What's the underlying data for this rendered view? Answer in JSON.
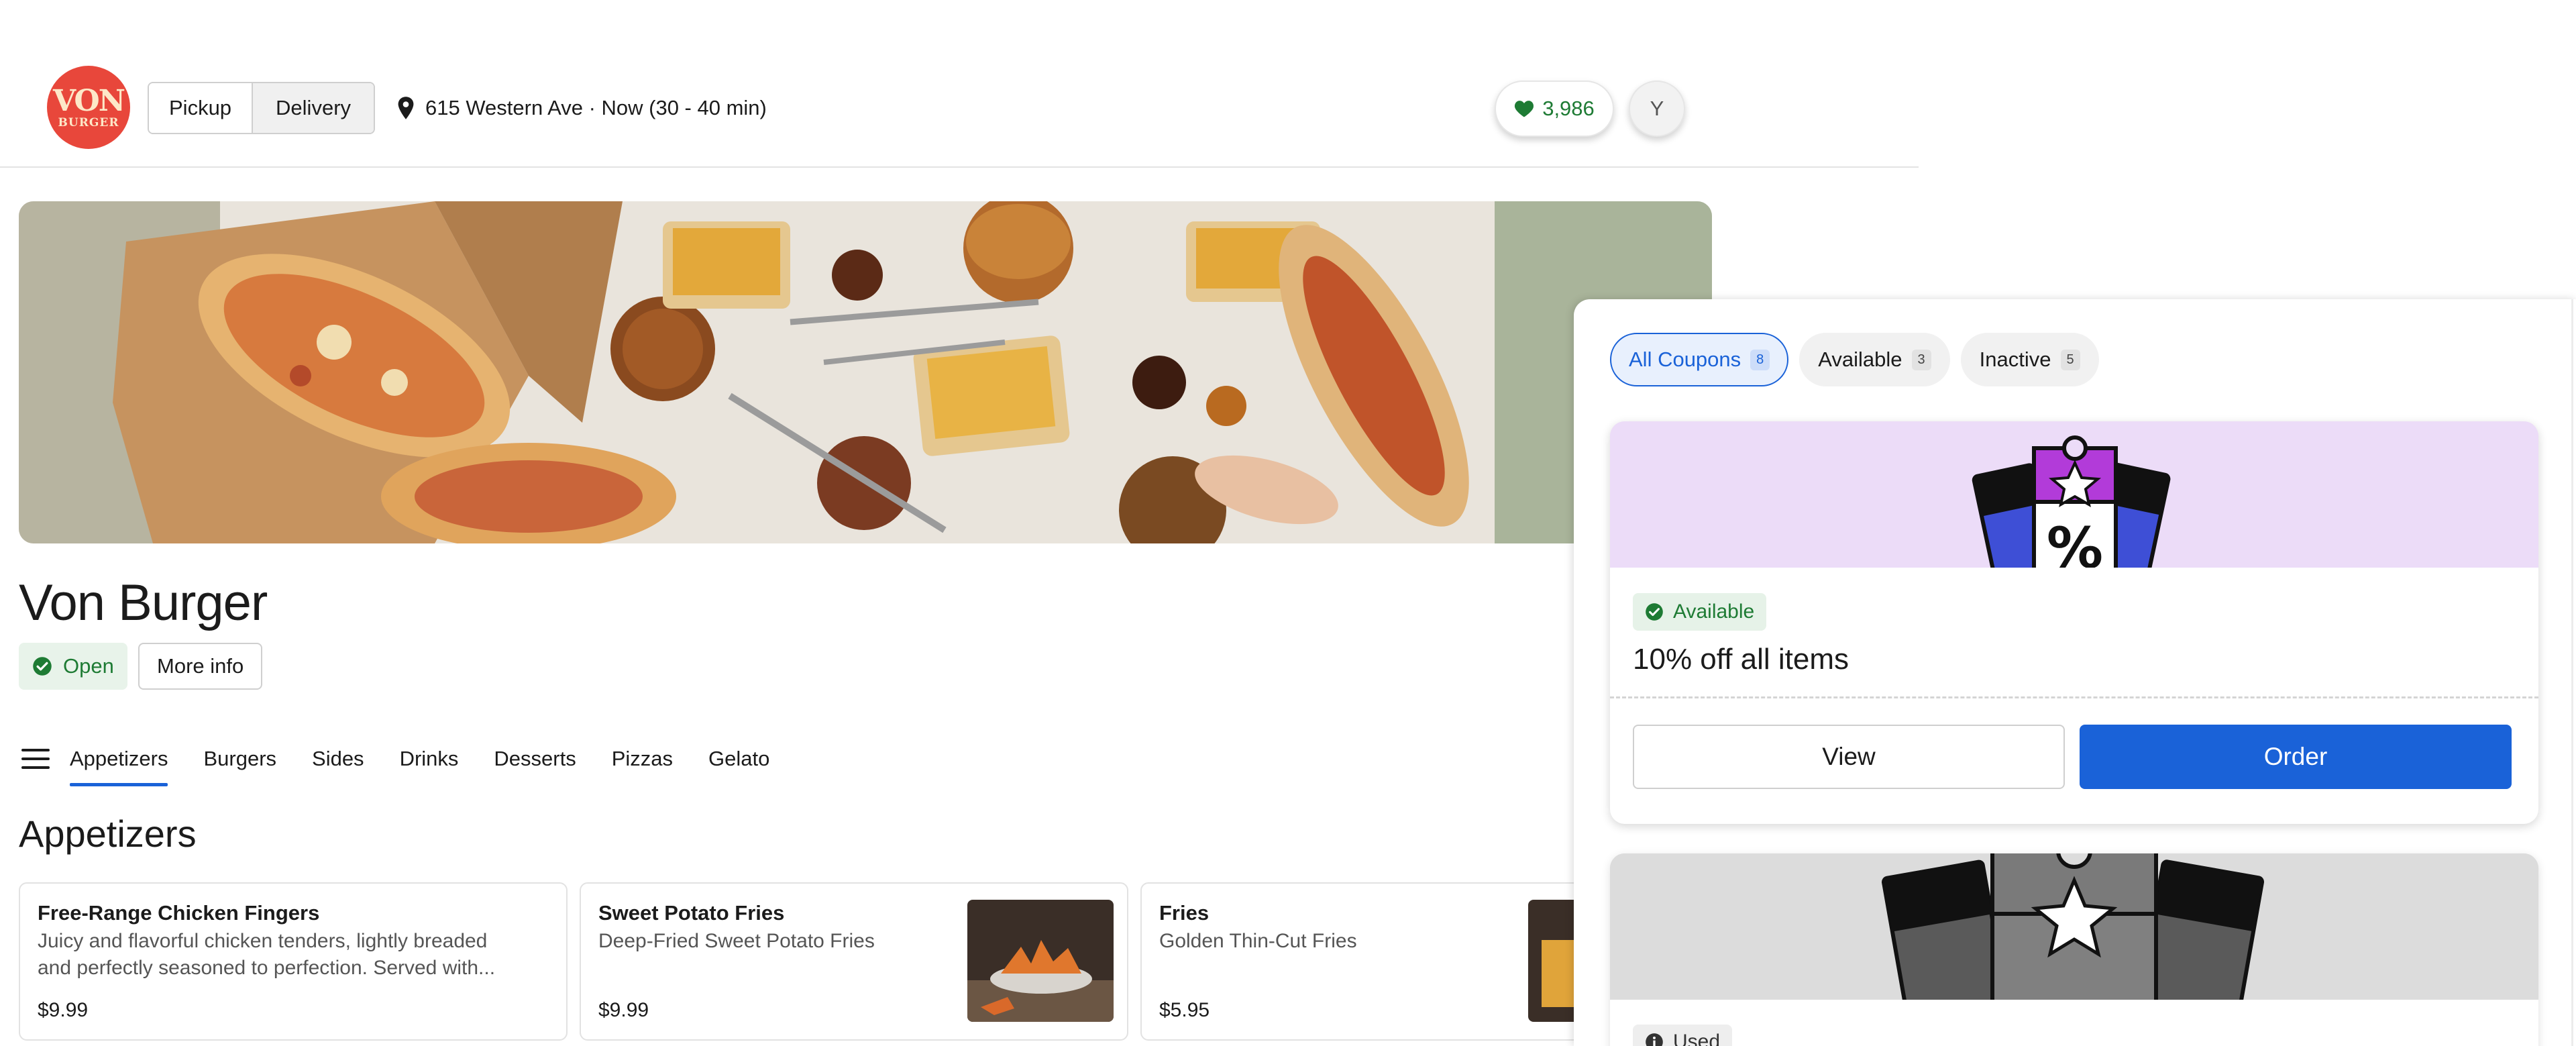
{
  "header": {
    "logo_text_line1": "VON",
    "logo_text_line2": "BURGER",
    "mode_options": [
      "Pickup",
      "Delivery"
    ],
    "address": "615 Western Ave · Now (30 - 40 min)",
    "favorites_count": "3,986",
    "avatar_initial": "Y"
  },
  "restaurant": {
    "name": "Von Burger",
    "status": "Open",
    "more_info_label": "More info"
  },
  "categories": [
    "Appetizers",
    "Burgers",
    "Sides",
    "Drinks",
    "Desserts",
    "Pizzas",
    "Gelato"
  ],
  "active_category": "Appetizers",
  "section_title": "Appetizers",
  "menu_items": [
    {
      "name": "Free-Range Chicken Fingers",
      "desc_line1": "Juicy and flavorful chicken tenders, lightly breaded",
      "desc_line2": "and perfectly seasoned to perfection. Served with...",
      "price": "$9.99"
    },
    {
      "name": "Sweet Potato Fries",
      "desc_line1": "Deep-Fried Sweet Potato Fries",
      "price": "$9.99"
    },
    {
      "name": "Fries",
      "desc_line1": "Golden Thin-Cut Fries",
      "price": "$5.95"
    }
  ],
  "coupons": {
    "tabs": [
      {
        "label": "All Coupons",
        "count": "8"
      },
      {
        "label": "Available",
        "count": "3"
      },
      {
        "label": "Inactive",
        "count": "5"
      }
    ],
    "active_tab": "All Coupons",
    "cards": [
      {
        "status": "Available",
        "title": "10% off all items",
        "view_label": "View",
        "order_label": "Order"
      },
      {
        "status": "Used"
      }
    ]
  },
  "colors": {
    "accent": "#1a62d8",
    "success": "#1e7b34",
    "brand": "#e8473b",
    "coupon_art_bg": "#ecdcf8"
  }
}
